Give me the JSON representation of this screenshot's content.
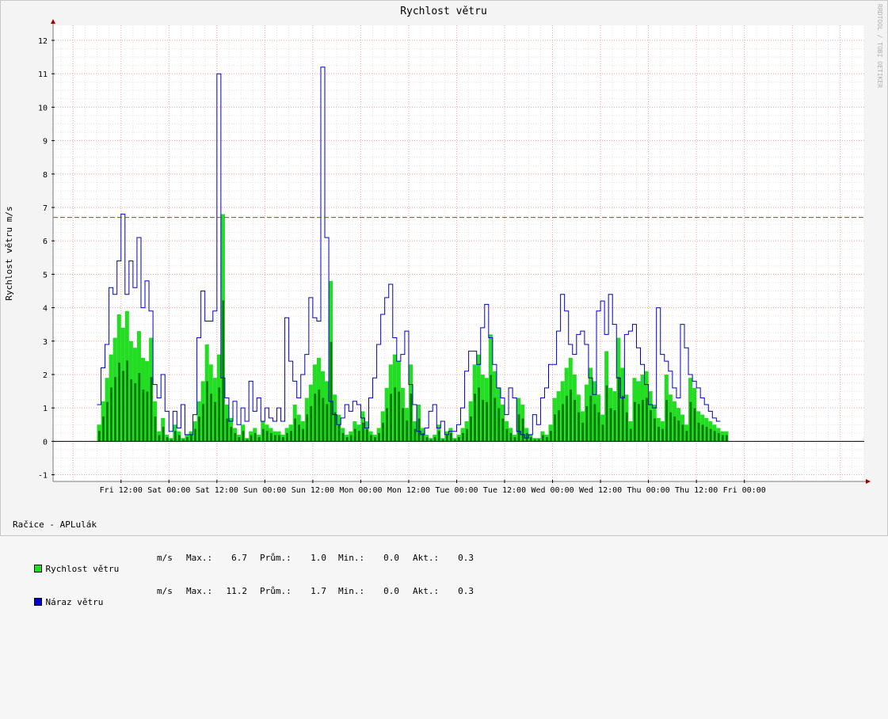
{
  "chart_data": {
    "type": "area",
    "title": "Rychlost větru",
    "ylabel": "Rychlost větru m/s",
    "watermark": "RRDTOOL / TOBI OETIKER",
    "ylim": [
      -1.2,
      12.45
    ],
    "yticks": [
      "-1",
      "0",
      "1",
      "2",
      "3",
      "4",
      "5",
      "6",
      "7",
      "8",
      "9",
      "10",
      "11",
      "12"
    ],
    "xlim_hours": [
      -17,
      186
    ],
    "xticks": [
      {
        "label": "Fri 12:00",
        "h": 0
      },
      {
        "label": "Sat 00:00",
        "h": 12
      },
      {
        "label": "Sat 12:00",
        "h": 24
      },
      {
        "label": "Sun 00:00",
        "h": 36
      },
      {
        "label": "Sun 12:00",
        "h": 48
      },
      {
        "label": "Mon 00:00",
        "h": 60
      },
      {
        "label": "Mon 12:00",
        "h": 72
      },
      {
        "label": "Tue 00:00",
        "h": 84
      },
      {
        "label": "Tue 12:00",
        "h": 96
      },
      {
        "label": "Wed 00:00",
        "h": 108
      },
      {
        "label": "Wed 12:00",
        "h": 120
      },
      {
        "label": "Thu 00:00",
        "h": 132
      },
      {
        "label": "Thu 12:00",
        "h": 144
      },
      {
        "label": "Fri 00:00",
        "h": 156
      }
    ],
    "hrule": {
      "value": 6.7,
      "color": "#6b5a2b"
    },
    "series": [
      {
        "name": "Rychlost větru",
        "color": "#22dd22",
        "dark_color": "#007a00",
        "step_hours": 1,
        "start_h": -6,
        "values": [
          0.5,
          1.2,
          1.9,
          2.6,
          3.1,
          3.8,
          3.4,
          3.9,
          3.0,
          2.8,
          3.3,
          2.5,
          2.4,
          3.1,
          1.2,
          0.3,
          0.7,
          0.2,
          0.1,
          0.5,
          0.3,
          0.1,
          0.2,
          0.3,
          0.6,
          1.2,
          1.8,
          2.9,
          2.3,
          1.9,
          2.6,
          6.8,
          1.1,
          0.7,
          0.4,
          0.2,
          0.5,
          0.1,
          0.3,
          0.4,
          0.2,
          0.6,
          0.5,
          0.4,
          0.3,
          0.3,
          0.2,
          0.4,
          0.5,
          1.1,
          0.8,
          0.6,
          1.3,
          1.7,
          2.3,
          2.5,
          2.1,
          1.8,
          4.8,
          1.4,
          0.8,
          0.4,
          0.2,
          0.3,
          0.6,
          0.5,
          0.9,
          0.6,
          0.3,
          0.2,
          0.4,
          0.9,
          1.6,
          2.3,
          2.6,
          2.4,
          1.6,
          1.0,
          2.3,
          0.6,
          1.1,
          0.4,
          0.2,
          0.1,
          0.2,
          0.5,
          0.1,
          0.3,
          0.4,
          0.1,
          0.2,
          0.4,
          0.6,
          1.2,
          2.3,
          2.6,
          2.0,
          1.9,
          3.2,
          2.1,
          1.6,
          1.1,
          0.6,
          0.4,
          0.2,
          1.3,
          1.1,
          0.4,
          0.2,
          0.1,
          0.1,
          0.3,
          0.2,
          0.5,
          1.3,
          1.5,
          1.8,
          2.2,
          2.5,
          2.0,
          1.4,
          0.9,
          1.7,
          2.2,
          1.8,
          1.4,
          0.8,
          2.7,
          1.6,
          1.5,
          3.1,
          2.2,
          1.4,
          0.6,
          1.9,
          1.8,
          2.0,
          2.1,
          1.5,
          1.1,
          0.7,
          0.6,
          2.0,
          1.4,
          1.2,
          1.0,
          0.8,
          0.5,
          1.9,
          1.6,
          0.9,
          0.8,
          0.7,
          0.6,
          0.5,
          0.4,
          0.3,
          0.3
        ]
      },
      {
        "name": "Náraz větru",
        "color": "#0000cc",
        "step_hours": 1,
        "start_h": -6,
        "values": [
          1.1,
          2.2,
          2.9,
          4.6,
          4.4,
          5.4,
          6.8,
          4.4,
          5.4,
          4.6,
          6.1,
          4.0,
          4.8,
          3.9,
          1.7,
          1.3,
          2.0,
          0.9,
          0.3,
          0.9,
          0.4,
          1.1,
          0.2,
          0.2,
          0.8,
          3.1,
          4.5,
          3.6,
          3.6,
          3.9,
          11.0,
          1.9,
          1.3,
          0.6,
          1.2,
          0.5,
          1.0,
          0.6,
          1.8,
          0.9,
          1.3,
          0.6,
          1.0,
          0.7,
          0.6,
          1.0,
          0.6,
          3.7,
          2.4,
          1.8,
          1.3,
          2.0,
          2.6,
          4.3,
          3.7,
          3.6,
          11.2,
          6.1,
          1.2,
          0.8,
          0.5,
          0.7,
          1.1,
          0.9,
          1.2,
          1.1,
          0.7,
          0.4,
          1.3,
          1.9,
          2.9,
          3.8,
          4.3,
          4.7,
          3.1,
          2.4,
          2.6,
          3.3,
          1.7,
          1.1,
          0.3,
          0.2,
          0.4,
          0.9,
          1.1,
          0.4,
          0.6,
          0.2,
          0.3,
          0.3,
          0.5,
          1.0,
          2.1,
          2.7,
          2.7,
          2.3,
          3.4,
          4.1,
          3.1,
          2.3,
          1.6,
          1.3,
          0.8,
          1.6,
          1.3,
          0.3,
          0.2,
          0.1,
          0.2,
          0.8,
          0.5,
          1.3,
          1.6,
          2.3,
          2.3,
          3.3,
          4.4,
          3.9,
          2.9,
          2.6,
          3.2,
          3.3,
          2.9,
          1.9,
          1.4,
          3.9,
          4.2,
          3.2,
          4.4,
          3.5,
          1.9,
          1.3,
          3.2,
          3.3,
          3.5,
          2.8,
          2.3,
          1.7,
          1.1,
          1.0,
          4.0,
          2.6,
          2.4,
          2.1,
          1.6,
          1.3,
          3.5,
          2.8,
          2.0,
          1.8,
          1.6,
          1.3,
          1.1,
          0.9,
          0.7,
          0.6
        ]
      }
    ]
  },
  "legend": {
    "station": "Račice - APLulák",
    "rows": [
      {
        "name": "Rychlost větru",
        "color": "#22dd22",
        "unit": "m/s",
        "max_label": "Max.:",
        "max": "6.7",
        "avg_label": "Prům.:",
        "avg": "1.0",
        "min_label": "Min.:",
        "min": "0.0",
        "cur_label": "Akt.:",
        "cur": "0.3"
      },
      {
        "name": "Náraz větru",
        "color": "#0000cc",
        "unit": "m/s",
        "max_label": "Max.:",
        "max": "11.2",
        "avg_label": "Prům.:",
        "avg": "1.7",
        "min_label": "Min.:",
        "min": "0.0",
        "cur_label": "Akt.:",
        "cur": "0.3"
      }
    ]
  }
}
